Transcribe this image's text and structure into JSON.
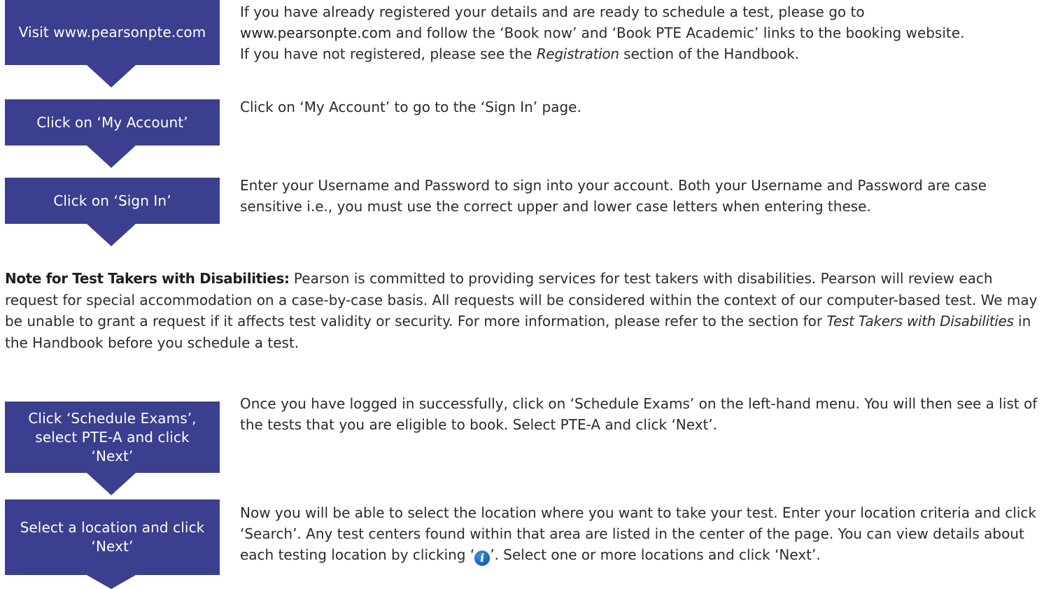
{
  "steps": [
    {
      "box_label": "Visit www.pearsonpte.com",
      "text_1": "If you have already registered your details and are ready to schedule a test, please go to",
      "url": "www.pearsonpte.com",
      "text_2": " and follow the ‘Book now’ and ‘Book PTE Academic’ links to the booking website.",
      "text_3": "If you have not registered, please see the ",
      "italic": "Registration",
      "text_4": " section of the Handbook."
    },
    {
      "box_label": "Click on ‘My Account’",
      "text": "Click on ‘My Account’ to go to the ‘Sign In’ page."
    },
    {
      "box_label": "Click on ‘Sign In’",
      "text": "Enter your Username and Password to sign into your account. Both your Username and Password are case sensitive i.e., you must use the correct upper and lower case letters when entering these."
    },
    {
      "box_label": "Click ‘Schedule Exams’, select PTE-A and click ‘Next’",
      "text": "Once you have logged in successfully, click on ‘Schedule Exams’ on the left-hand menu. You will then see a list of the tests that you are eligible to book. Select PTE-A and click ‘Next’."
    },
    {
      "box_label": "Select a location and click ‘Next’",
      "text_1": "Now you will be able to select the location where you want to take your test. Enter your location criteria and click ‘Search’. Any test centers found within that area are listed in the center of the page. You can view details about each testing location by clicking ‘",
      "text_2": "’. Select one or more locations and click ‘Next’."
    }
  ],
  "note": {
    "heading": "Note for Test Takers with Disabilities:",
    "text_1": " Pearson is committed to providing services for test takers with disabilities. Pearson will review each request for special accommodation on a case-by-case basis. All requests will be considered within the context of our computer-based test. We may be unable to grant a request if it affects test validity or security. For more information, please refer to the section for ",
    "italic": "Test Takers with Disabilities",
    "text_2": " in the Handbook before you schedule a test."
  },
  "icons": {
    "info": "info-icon"
  },
  "colors": {
    "box": "#3a3f8f",
    "info_icon": "#1560b8"
  }
}
